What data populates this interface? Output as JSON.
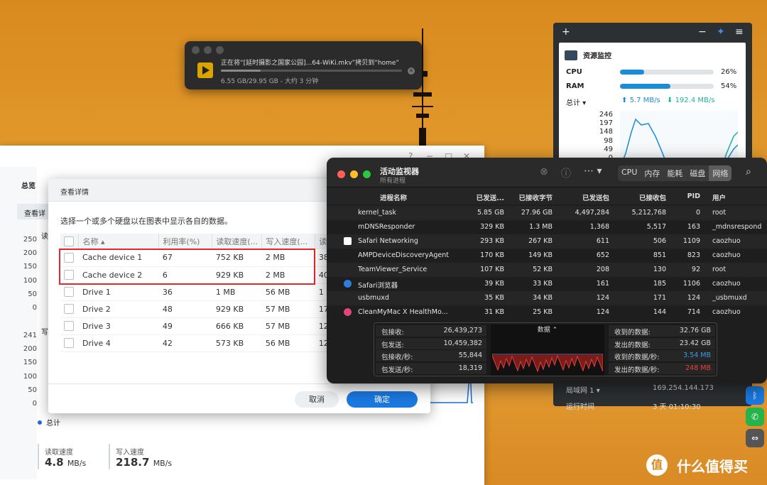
{
  "copy_dialog": {
    "title": "正在将“[延时摄影之国家公园]...64-WiKi.mkv”拷贝到“home”",
    "status": "6.55 GB/29.95 GB - 大约 3 分钟",
    "progress": 0.219
  },
  "resource_monitor": {
    "title": "资源监控",
    "cpu_label": "CPU",
    "cpu_value": "26%",
    "cpu_pct": 26,
    "ram_label": "RAM",
    "ram_value": "54%",
    "ram_pct": 54,
    "total_label": "总计",
    "up_speed": "5.7 MB/s",
    "down_speed": "192.4 MB/s",
    "y_ticks": [
      "246",
      "197",
      "148",
      "98",
      "49",
      "0"
    ],
    "lan_label": "局域网 1",
    "lan_value": "169.254.144.173",
    "uptime_label": "运行时间",
    "uptime_value": "3 天 01:10:30"
  },
  "storage_window": {
    "tab_overview": "总览",
    "tab_details": "查看详",
    "read_label": "读",
    "write_label": "写",
    "read_ticks": [
      "250",
      "200",
      "150",
      "100",
      "50",
      "0"
    ],
    "write_ticks": [
      "241",
      "200",
      "150",
      "100",
      "50",
      "0"
    ],
    "legend_total": "总计",
    "read_speed_label": "读取速度",
    "read_speed_value": "4.8",
    "read_speed_unit": "MB/s",
    "write_speed_label": "写入速度",
    "write_speed_value": "218.7",
    "write_speed_unit": "MB/s"
  },
  "detail_dialog": {
    "title": "查看详情",
    "intro": "选择一个或多个硬盘以在图表中显示各自的数据。",
    "columns": [
      "名称 ▴",
      "利用率(%)",
      "读取速度(...",
      "写入速度(...",
      "读"
    ],
    "rows": [
      [
        "Cache device 1",
        "67",
        "752 KB",
        "2 MB",
        "38"
      ],
      [
        "Cache device 2",
        "6",
        "929 KB",
        "2 MB",
        "40"
      ],
      [
        "Drive 1",
        "36",
        "1 MB",
        "56 MB",
        "1"
      ],
      [
        "Drive 2",
        "48",
        "929 KB",
        "57 MB",
        "17"
      ],
      [
        "Drive 3",
        "49",
        "666 KB",
        "57 MB",
        "12"
      ],
      [
        "Drive 4",
        "42",
        "573 KB",
        "56 MB",
        "12"
      ]
    ],
    "cancel": "取消",
    "ok": "确定"
  },
  "activity_monitor": {
    "title": "活动监视器",
    "subtitle": "所有进程",
    "tabs": [
      "CPU",
      "内存",
      "能耗",
      "磁盘",
      "网络"
    ],
    "active_tab": "网络",
    "columns": [
      "进程名称",
      "已发送...",
      "已接收字节",
      "已发送包",
      "已接收包",
      "PID",
      "用户"
    ],
    "rows": [
      [
        "kernel_task",
        "5.85 GB",
        "27.96 GB",
        "4,497,284",
        "5,212,768",
        "0",
        "root"
      ],
      [
        "mDNSResponder",
        "329 KB",
        "1.3 MB",
        "1,368",
        "5,517",
        "163",
        "_mdnsrespond"
      ],
      [
        "Safari Networking",
        "293 KB",
        "267 KB",
        "611",
        "506",
        "1109",
        "caozhuo"
      ],
      [
        "AMPDeviceDiscoveryAgent",
        "170 KB",
        "149 KB",
        "652",
        "851",
        "823",
        "caozhuo"
      ],
      [
        "TeamViewer_Service",
        "107 KB",
        "52 KB",
        "208",
        "130",
        "92",
        "root"
      ],
      [
        "Safari浏览器",
        "39 KB",
        "33 KB",
        "161",
        "185",
        "1106",
        "caozhuo"
      ],
      [
        "usbmuxd",
        "35 KB",
        "34 KB",
        "124",
        "171",
        "124",
        "_usbmuxd"
      ],
      [
        "CleanMyMac X HealthMo...",
        "31 KB",
        "25 KB",
        "124",
        "144",
        "714",
        "caozhuo"
      ]
    ],
    "summary_left": [
      [
        "包接收:",
        "26,439,273"
      ],
      [
        "包发送:",
        "10,459,382"
      ],
      [
        "包接收/秒:",
        "55,844"
      ],
      [
        "包发送/秒:",
        "18,319"
      ]
    ],
    "summary_center": "数据",
    "summary_right": [
      [
        "收到的数据:",
        "32.76 GB"
      ],
      [
        "发出的数据:",
        "23.42 GB"
      ],
      [
        "收到的数据/秒:",
        "3.54 MB"
      ],
      [
        "发出的数据/秒:",
        "248 MB"
      ]
    ],
    "recv_color": "#3b9be8",
    "send_color": "#e8413b"
  },
  "watermark": "什么值得买"
}
